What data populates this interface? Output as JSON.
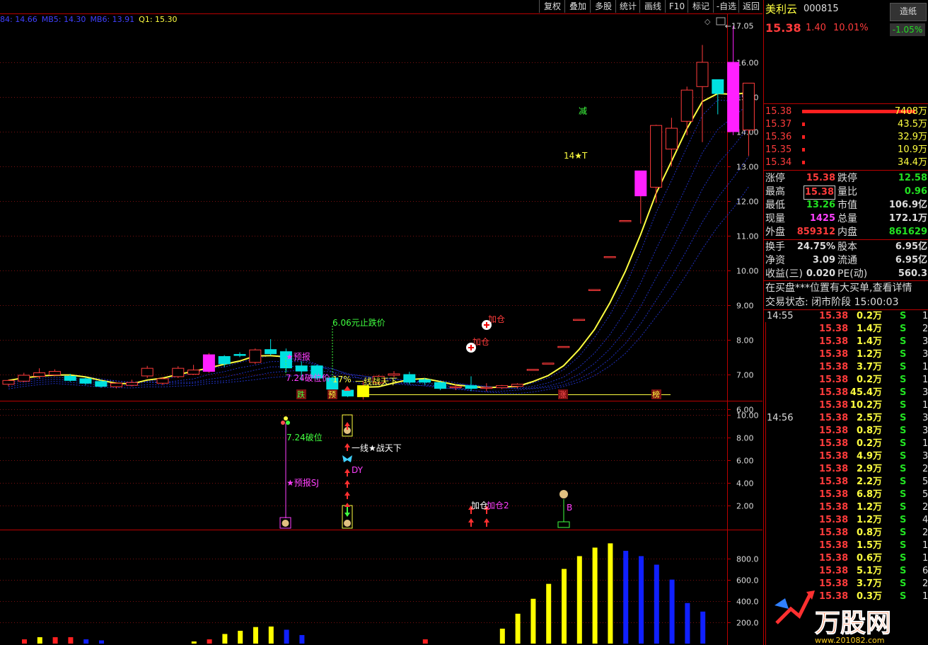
{
  "toolbar": {
    "items": [
      "复权",
      "叠加",
      "多股",
      "统计",
      "画线",
      "F10",
      "标记",
      "-自选",
      "返回"
    ]
  },
  "ma_legend": {
    "items": [
      {
        "text": "84: 14.66",
        "color": "#4040ff"
      },
      {
        "text": "MB5: 14.30",
        "color": "#4040ff"
      },
      {
        "text": "MB6: 13.91",
        "color": "#4040ff"
      },
      {
        "text": "Q1: 15.30",
        "color": "#ffff40"
      }
    ]
  },
  "stock": {
    "name": "美利云",
    "code": "000815",
    "tag": "造纸",
    "tag_change": "-1.05%",
    "price": "15.38",
    "change": "1.40",
    "pct": "10.01%"
  },
  "bids": [
    {
      "price": "15.38",
      "vol": "7408万"
    },
    {
      "price": "15.37",
      "vol": "43.5万"
    },
    {
      "price": "15.36",
      "vol": "32.9万"
    },
    {
      "price": "15.35",
      "vol": "10.9万"
    },
    {
      "price": "15.34",
      "vol": "34.4万"
    }
  ],
  "stats": [
    {
      "l1": "涨停",
      "v1": "15.38",
      "c1": "red",
      "l2": "跌停",
      "v2": "12.58",
      "c2": "green"
    },
    {
      "l1": "最高",
      "v1": "15.38",
      "c1": "red",
      "l2": "量比",
      "v2": "0.96",
      "c2": "green"
    },
    {
      "l1": "最低",
      "v1": "13.26",
      "c1": "green",
      "l2": "市值",
      "v2": "106.9亿",
      "c2": "white"
    },
    {
      "l1": "现量",
      "v1": "1425",
      "c1": "mag",
      "l2": "总量",
      "v2": "172.1万",
      "c2": "white"
    },
    {
      "l1": "外盘",
      "v1": "859312",
      "c1": "red",
      "l2": "内盘",
      "v2": "861629",
      "c2": "green"
    }
  ],
  "stats2": [
    {
      "l1": "换手",
      "v1": "24.75%",
      "l2": "股本",
      "v2": "6.95亿"
    },
    {
      "l1": "净资",
      "v1": "3.09",
      "l2": "流通",
      "v2": "6.95亿"
    },
    {
      "l1": "收益(三)",
      "v1": "0.020",
      "l2": "PE(动)",
      "v2": "560.3"
    }
  ],
  "notice": "在买盘***位置有大买单,查看详情",
  "trade_status": "交易状态: 闭市阶段 15:00:03",
  "ticks": [
    {
      "time": "14:55",
      "price": "15.38",
      "vol": "0.2万",
      "side": "S",
      "n": "1"
    },
    {
      "time": "",
      "price": "15.38",
      "vol": "1.4万",
      "side": "S",
      "n": "2"
    },
    {
      "time": "",
      "price": "15.38",
      "vol": "1.4万",
      "side": "S",
      "n": "3"
    },
    {
      "time": "",
      "price": "15.38",
      "vol": "1.2万",
      "side": "S",
      "n": "3"
    },
    {
      "time": "",
      "price": "15.38",
      "vol": "3.7万",
      "side": "S",
      "n": "1"
    },
    {
      "time": "",
      "price": "15.38",
      "vol": "0.2万",
      "side": "S",
      "n": "1"
    },
    {
      "time": "",
      "price": "15.38",
      "vol": "45.4万",
      "side": "S",
      "n": "3"
    },
    {
      "time": "",
      "price": "15.38",
      "vol": "10.2万",
      "side": "S",
      "n": "1"
    },
    {
      "time": "14:56",
      "price": "15.38",
      "vol": "2.5万",
      "side": "S",
      "n": "3"
    },
    {
      "time": "",
      "price": "15.38",
      "vol": "0.8万",
      "side": "S",
      "n": "3"
    },
    {
      "time": "",
      "price": "15.38",
      "vol": "0.2万",
      "side": "S",
      "n": "1"
    },
    {
      "time": "",
      "price": "15.38",
      "vol": "4.9万",
      "side": "S",
      "n": "3"
    },
    {
      "time": "",
      "price": "15.38",
      "vol": "2.9万",
      "side": "S",
      "n": "2"
    },
    {
      "time": "",
      "price": "15.38",
      "vol": "2.2万",
      "side": "S",
      "n": "5"
    },
    {
      "time": "",
      "price": "15.38",
      "vol": "6.8万",
      "side": "S",
      "n": "5"
    },
    {
      "time": "",
      "price": "15.38",
      "vol": "1.2万",
      "side": "S",
      "n": "2"
    },
    {
      "time": "",
      "price": "15.38",
      "vol": "1.2万",
      "side": "S",
      "n": "4"
    },
    {
      "time": "",
      "price": "15.38",
      "vol": "0.8万",
      "side": "S",
      "n": "2"
    },
    {
      "time": "",
      "price": "15.38",
      "vol": "1.5万",
      "side": "S",
      "n": "1"
    },
    {
      "time": "",
      "price": "15.38",
      "vol": "0.6万",
      "side": "S",
      "n": "1"
    },
    {
      "time": "",
      "price": "15.38",
      "vol": "5.1万",
      "side": "S",
      "n": "6"
    },
    {
      "time": "",
      "price": "15.38",
      "vol": "3.7万",
      "side": "S",
      "n": "2"
    },
    {
      "time": "",
      "price": "15.38",
      "vol": "0.3万",
      "side": "S",
      "n": "1"
    }
  ],
  "logo_text": "万股网",
  "logo_url_text": "www.201082.com",
  "chart_data": {
    "type": "candlestick",
    "price_axis": {
      "ticks": [
        "16.00",
        "15.00",
        "14.00",
        "13.00",
        "12.00",
        "11.00",
        "10.00",
        "9.00",
        "8.00",
        "7.00",
        "6.00"
      ],
      "ylim": [
        5.7,
        17.3
      ]
    },
    "high_label": "17.05",
    "candles": [
      {
        "o": 6.72,
        "c": 6.83,
        "h": 6.86,
        "l": 6.66
      },
      {
        "o": 6.81,
        "c": 6.98,
        "h": 7.05,
        "l": 6.78
      },
      {
        "o": 6.95,
        "c": 7.05,
        "h": 7.18,
        "l": 6.88
      },
      {
        "o": 6.99,
        "c": 7.09,
        "h": 7.15,
        "l": 6.95
      },
      {
        "o": 6.95,
        "c": 6.83,
        "h": 7.02,
        "l": 6.79
      },
      {
        "o": 6.88,
        "c": 6.75,
        "h": 6.92,
        "l": 6.7
      },
      {
        "o": 6.8,
        "c": 6.66,
        "h": 6.85,
        "l": 6.62
      },
      {
        "o": 6.65,
        "c": 6.75,
        "h": 6.78,
        "l": 6.6
      },
      {
        "o": 6.69,
        "c": 6.77,
        "h": 6.85,
        "l": 6.66
      },
      {
        "o": 6.96,
        "c": 7.18,
        "h": 7.25,
        "l": 6.9
      },
      {
        "o": 6.75,
        "c": 6.88,
        "h": 6.93,
        "l": 6.7
      },
      {
        "o": 6.94,
        "c": 7.18,
        "h": 7.24,
        "l": 6.9
      },
      {
        "o": 7.01,
        "c": 7.13,
        "h": 7.28,
        "l": 6.99
      },
      {
        "o": 7.09,
        "c": 7.57,
        "h": 7.62,
        "l": 7.05
      },
      {
        "o": 7.52,
        "c": 7.31,
        "h": 7.56,
        "l": 7.22
      },
      {
        "o": 7.58,
        "c": 7.55,
        "h": 7.64,
        "l": 7.5
      },
      {
        "o": 7.35,
        "c": 7.71,
        "h": 7.75,
        "l": 7.3
      },
      {
        "o": 7.72,
        "c": 7.6,
        "h": 8.02,
        "l": 7.55
      },
      {
        "o": 7.66,
        "c": 7.19,
        "h": 7.75,
        "l": 7.08
      },
      {
        "o": 7.25,
        "c": 7.1,
        "h": 7.38,
        "l": 6.82
      },
      {
        "o": 7.25,
        "c": 6.9,
        "h": 7.29,
        "l": 6.85
      },
      {
        "o": 6.9,
        "c": 6.58,
        "h": 6.95,
        "l": 6.5
      },
      {
        "o": 6.55,
        "c": 6.38,
        "h": 6.6,
        "l": 6.35
      },
      {
        "o": 6.36,
        "c": 6.68,
        "h": 6.82,
        "l": 6.28
      },
      {
        "o": 6.76,
        "c": 6.95,
        "h": 6.99,
        "l": 6.7
      },
      {
        "o": 6.98,
        "c": 7.02,
        "h": 7.1,
        "l": 6.92
      },
      {
        "o": 7.0,
        "c": 6.78,
        "h": 7.08,
        "l": 6.72
      },
      {
        "o": 6.85,
        "c": 6.78,
        "h": 6.9,
        "l": 6.7
      },
      {
        "o": 6.77,
        "c": 6.6,
        "h": 6.8,
        "l": 6.55
      },
      {
        "o": 6.62,
        "c": 6.65,
        "h": 6.72,
        "l": 6.55
      },
      {
        "o": 6.68,
        "c": 6.6,
        "h": 6.95,
        "l": 6.52
      },
      {
        "o": 6.6,
        "c": 6.63,
        "h": 6.75,
        "l": 6.52
      },
      {
        "o": 6.62,
        "c": 6.68,
        "h": 6.7,
        "l": 6.58
      },
      {
        "o": 6.66,
        "c": 6.72,
        "h": 6.75,
        "l": 6.6
      },
      {
        "o": 7.15,
        "c": 7.15,
        "h": 7.15,
        "l": 7.15
      },
      {
        "o": 7.33,
        "c": 7.33,
        "h": 7.33,
        "l": 7.33
      },
      {
        "o": 7.81,
        "c": 7.81,
        "h": 7.81,
        "l": 7.81
      },
      {
        "o": 8.59,
        "c": 8.59,
        "h": 8.59,
        "l": 8.59
      },
      {
        "o": 9.45,
        "c": 9.45,
        "h": 9.45,
        "l": 9.45
      },
      {
        "o": 10.4,
        "c": 10.4,
        "h": 10.4,
        "l": 10.4
      },
      {
        "o": 11.44,
        "c": 11.44,
        "h": 11.44,
        "l": 11.44
      },
      {
        "o": 12.15,
        "c": 12.87,
        "h": 12.87,
        "l": 11.35
      },
      {
        "o": 12.4,
        "c": 14.18,
        "h": 14.2,
        "l": 11.95
      },
      {
        "o": 13.5,
        "c": 14.1,
        "h": 14.4,
        "l": 13.0
      },
      {
        "o": 14.3,
        "c": 15.2,
        "h": 15.3,
        "l": 13.9
      },
      {
        "o": 15.3,
        "c": 16.0,
        "h": 16.5,
        "l": 13.7
      },
      {
        "o": 15.5,
        "c": 15.1,
        "h": 15.5,
        "l": 14.5
      },
      {
        "o": 16.0,
        "c": 14.0,
        "h": 17.05,
        "l": 13.9
      },
      {
        "o": 14.05,
        "c": 15.4,
        "h": 15.4,
        "l": 13.3
      }
    ],
    "candle_colors": {
      "up": "#ff3b3b",
      "down": "#00e0e0",
      "limit_up_fill": "#ff20ff",
      "signal_fill": "#ffff00"
    },
    "signal_band": {
      "value": 6.42
    },
    "annotations": [
      {
        "text": "6.06元止跌价",
        "color": "#40ff40"
      },
      {
        "text": "7.24破位价",
        "color": "#ff40ff"
      },
      {
        "text": "17%",
        "color": "#ffff40"
      },
      {
        "text": "一线战天下",
        "color": "#ffff40"
      },
      {
        "text": "加仓",
        "color": "#ff3b3b"
      },
      {
        "text": "加仓",
        "color": "#ff3b3b"
      },
      {
        "text": "14★T",
        "color": "#ffff40"
      },
      {
        "text": "减",
        "color": "#40ff40"
      },
      {
        "text": "★预报",
        "color": "#ff40ff"
      }
    ],
    "badges": [
      {
        "text": "跌",
        "color": "#40ff40"
      },
      {
        "text": "预",
        "color": "#ffff40"
      },
      {
        "text": "涨",
        "color": "#ff5050"
      },
      {
        "text": "榜",
        "color": "#ffff40"
      }
    ],
    "signal_panel": {
      "ticks": [
        "10.00",
        "8.00",
        "6.00",
        "4.00",
        "2.00"
      ],
      "ylim": [
        0,
        11
      ],
      "labels": [
        {
          "text": "7.24破位",
          "color": "#40ff40"
        },
        {
          "text": "★预报SJ",
          "color": "#ff40ff"
        },
        {
          "text": "一线★战天下",
          "color": "#ffffff"
        },
        {
          "text": "DY",
          "color": "#ff40ff"
        },
        {
          "text": "加仓",
          "color": "#ffffff"
        },
        {
          "text": "加仓2",
          "color": "#ff40ff"
        },
        {
          "text": "B",
          "color": "#ff40ff"
        }
      ]
    },
    "volume_panel": {
      "ticks": [
        "800.0",
        "600.0",
        "400.0",
        "200.0"
      ],
      "ylim": [
        0,
        1000
      ],
      "bars": [
        {
          "v": 40,
          "c": "red"
        },
        {
          "v": 60,
          "c": "yellow"
        },
        {
          "v": 60,
          "c": "red"
        },
        {
          "v": 60,
          "c": "red"
        },
        {
          "v": 40,
          "c": "blue"
        },
        {
          "v": 30,
          "c": "blue"
        },
        {
          "v": 0,
          "c": "none"
        },
        {
          "v": 0,
          "c": "none"
        },
        {
          "v": 0,
          "c": "none"
        },
        {
          "v": 0,
          "c": "none"
        },
        {
          "v": 0,
          "c": "none"
        },
        {
          "v": 20,
          "c": "yellow"
        },
        {
          "v": 40,
          "c": "red"
        },
        {
          "v": 90,
          "c": "yellow"
        },
        {
          "v": 120,
          "c": "yellow"
        },
        {
          "v": 155,
          "c": "yellow"
        },
        {
          "v": 160,
          "c": "yellow"
        },
        {
          "v": 130,
          "c": "blue"
        },
        {
          "v": 80,
          "c": "blue"
        },
        {
          "v": 0,
          "c": "none"
        },
        {
          "v": 0,
          "c": "none"
        },
        {
          "v": 0,
          "c": "none"
        },
        {
          "v": 0,
          "c": "none"
        },
        {
          "v": 0,
          "c": "none"
        },
        {
          "v": 0,
          "c": "none"
        },
        {
          "v": 0,
          "c": "none"
        },
        {
          "v": 40,
          "c": "red"
        },
        {
          "v": 0,
          "c": "none"
        },
        {
          "v": 0,
          "c": "none"
        },
        {
          "v": 0,
          "c": "none"
        },
        {
          "v": 0,
          "c": "none"
        },
        {
          "v": 140,
          "c": "yellow"
        },
        {
          "v": 280,
          "c": "yellow"
        },
        {
          "v": 420,
          "c": "yellow"
        },
        {
          "v": 560,
          "c": "yellow"
        },
        {
          "v": 700,
          "c": "yellow"
        },
        {
          "v": 820,
          "c": "yellow"
        },
        {
          "v": 900,
          "c": "yellow"
        },
        {
          "v": 940,
          "c": "yellow"
        },
        {
          "v": 870,
          "c": "blue"
        },
        {
          "v": 820,
          "c": "blue"
        },
        {
          "v": 740,
          "c": "blue"
        },
        {
          "v": 600,
          "c": "blue"
        },
        {
          "v": 380,
          "c": "blue"
        },
        {
          "v": 300,
          "c": "blue"
        }
      ]
    }
  }
}
